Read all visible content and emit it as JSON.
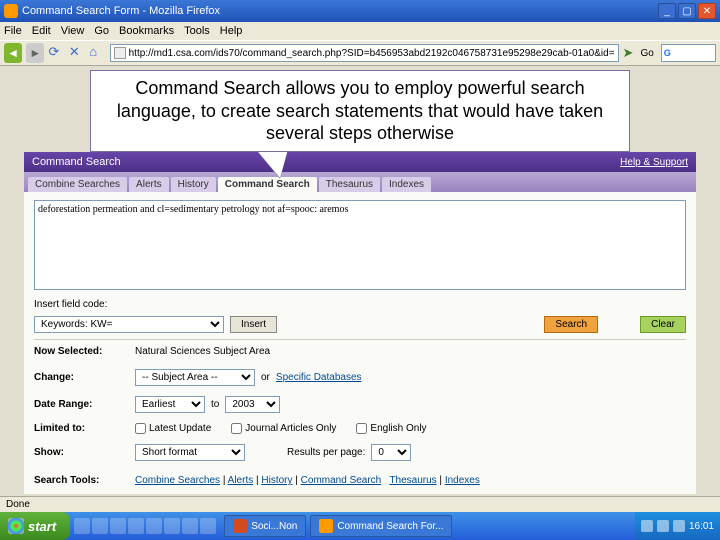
{
  "window": {
    "title": "Command Search Form - Mozilla Firefox",
    "url": "http://md1.csa.com/ids70/command_search.php?SID=b456953abd2192c046758731e95298e29cab-01a0&id="
  },
  "menu": {
    "items": [
      "File",
      "Edit",
      "View",
      "Go",
      "Bookmarks",
      "Tools",
      "Help"
    ]
  },
  "callout": "Command Search allows you to employ powerful search language, to create search statements that would have taken several steps otherwise",
  "header": {
    "title": "Command Search",
    "help": "Help & Support"
  },
  "tabs": [
    "Combine Searches",
    "Alerts",
    "History",
    "Command Search",
    "Thesaurus",
    "Indexes"
  ],
  "tabs_active": 3,
  "cmdtext": "deforestation permeation and cl=sedimentary petrology not af=spooc: aremos",
  "insert_label": "Insert field code:",
  "field_sel": "Keywords: KW=",
  "insert_btn": "Insert",
  "search_btn": "Search",
  "clear_btn": "Clear",
  "now_selected": {
    "lbl": "Now Selected:",
    "val": "Natural Sciences Subject Area"
  },
  "change": {
    "lbl": "Change:",
    "sel": "-- Subject Area --",
    "or": "or",
    "link": "Specific Databases"
  },
  "date": {
    "lbl": "Date Range:",
    "from": "Earliest",
    "to_lbl": "to",
    "to": "2003"
  },
  "limited": {
    "lbl": "Limited to:",
    "opts": [
      "Latest Update",
      "Journal Articles Only",
      "English Only"
    ]
  },
  "show": {
    "lbl": "Show:",
    "sel": "Short format",
    "rpp_lbl": "Results per page:",
    "rpp": "0"
  },
  "tools": {
    "lbl": "Search Tools:",
    "links": [
      "Combine Searches",
      "Alerts",
      "History",
      "Command Search",
      "Thesaurus",
      "Indexes"
    ]
  },
  "status": "Done",
  "taskbar": {
    "start": "start",
    "tasks": [
      "Soci...Non",
      "Command Search For..."
    ],
    "time": "16:01"
  },
  "go_label": "Go"
}
